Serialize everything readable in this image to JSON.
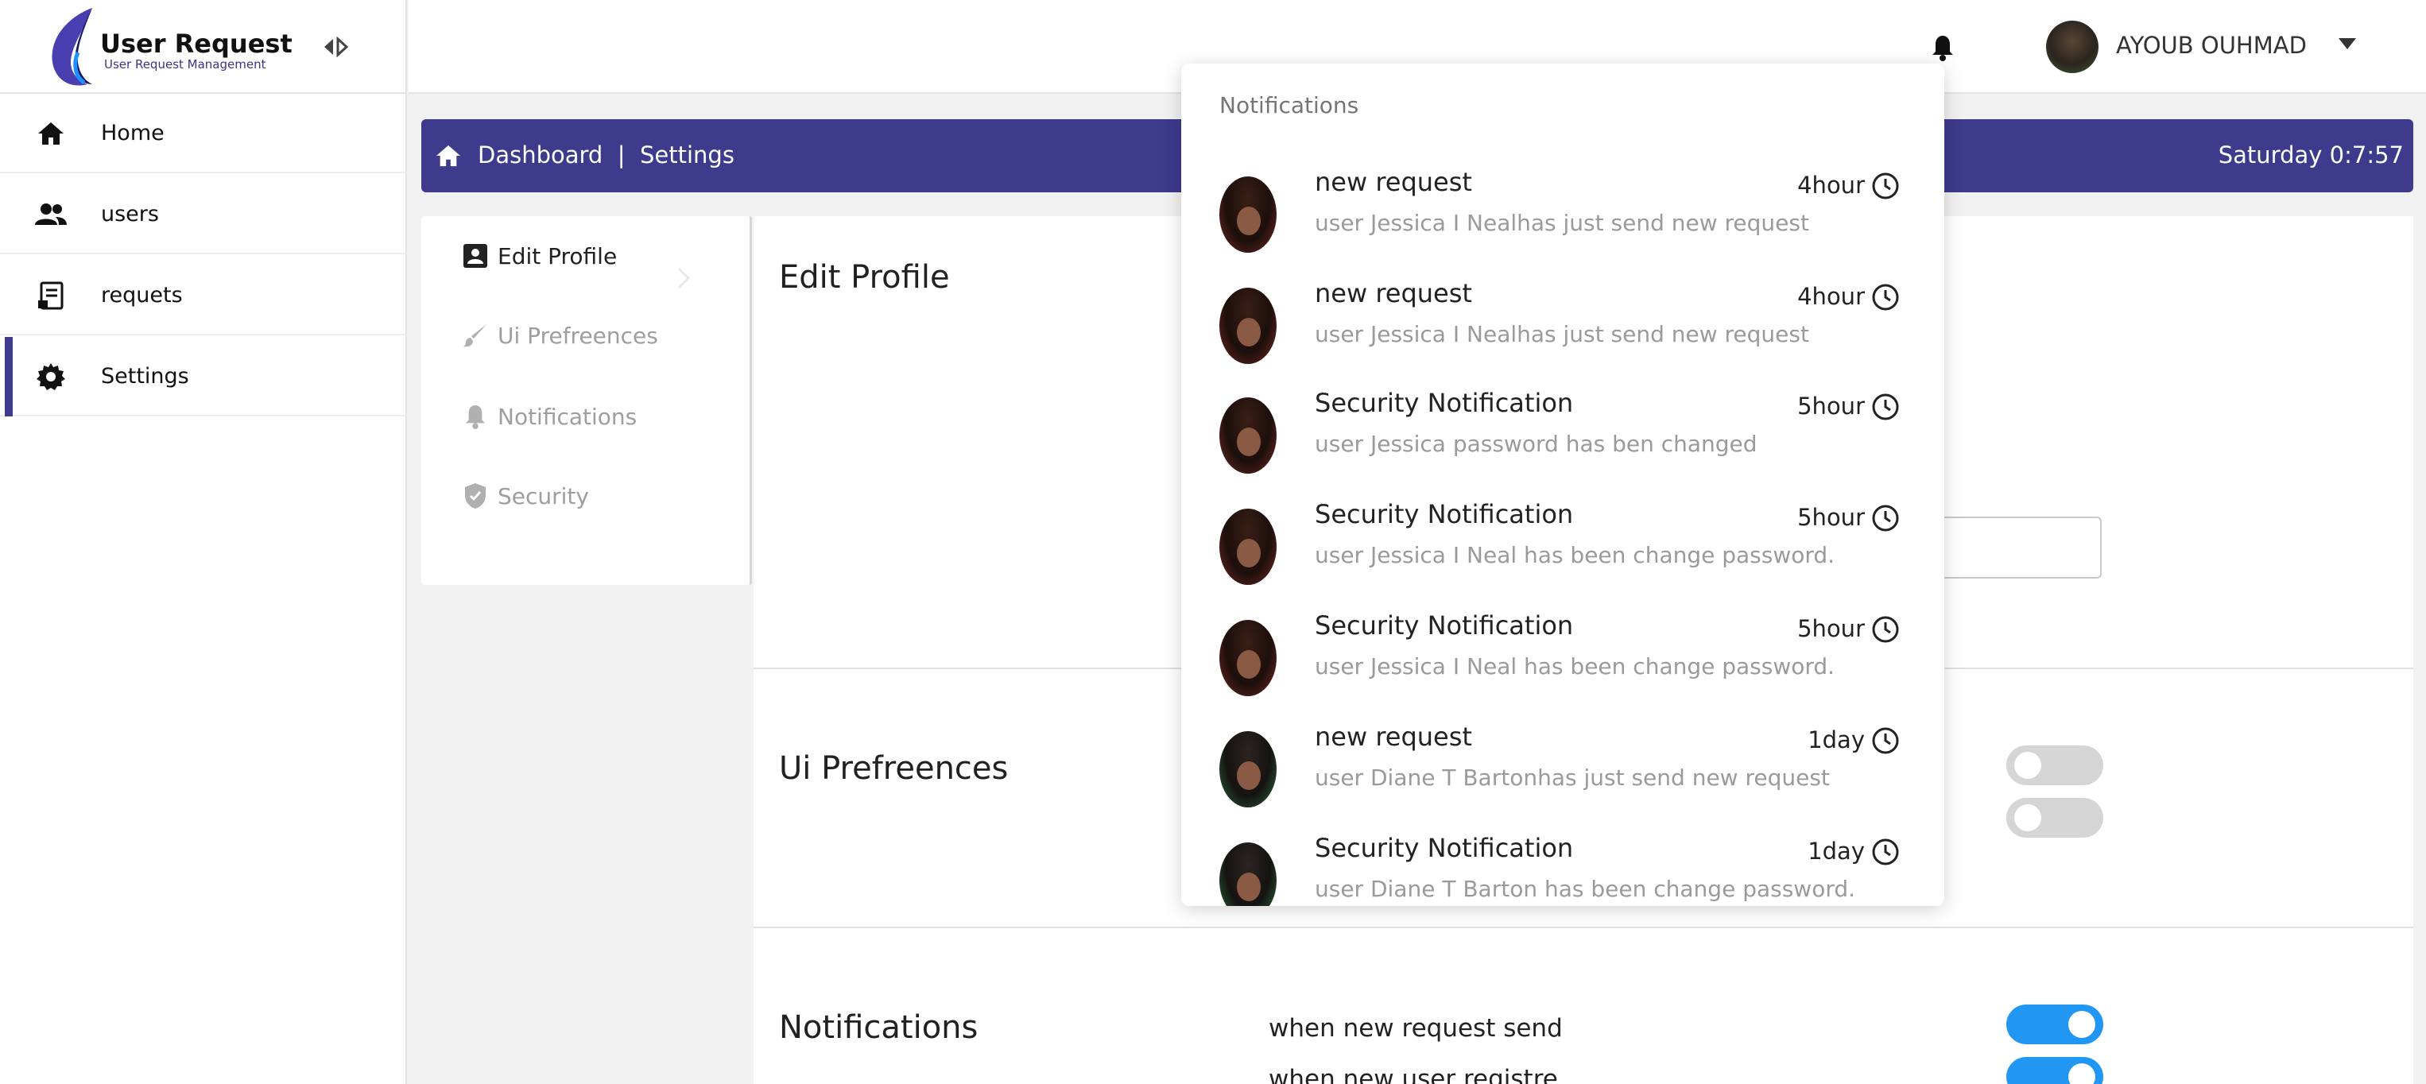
{
  "brand": {
    "title": "User Request",
    "subtitle": "User Request Management"
  },
  "sidebar": {
    "items": [
      {
        "label": "Home",
        "icon": "home-icon",
        "active": false
      },
      {
        "label": "users",
        "icon": "users-icon",
        "active": false
      },
      {
        "label": "requets",
        "icon": "requests-icon",
        "active": false
      },
      {
        "label": "Settings",
        "icon": "gear-icon",
        "active": true
      }
    ]
  },
  "header": {
    "user_name": "AYOUB OUHMAD"
  },
  "breadcrumb": {
    "text": "Dashboard  |  Settings",
    "clock": "Saturday 0:7:57"
  },
  "settings_menu": {
    "items": [
      {
        "label": "Edit Profile",
        "icon": "profile-icon",
        "active": true
      },
      {
        "label": "Ui Prefreences",
        "icon": "brush-icon",
        "active": false
      },
      {
        "label": "Notifications",
        "icon": "bell-icon",
        "active": false
      },
      {
        "label": "Security",
        "icon": "shield-icon",
        "active": false
      }
    ]
  },
  "sections": {
    "edit_profile": "Edit Profile",
    "ui_preferences": "Ui Prefreences",
    "notifications": "Notifications"
  },
  "notification_prefs": [
    {
      "label": "when new request send",
      "enabled": true
    },
    {
      "label": "when new user registre",
      "enabled": true
    }
  ],
  "ui_toggles": [
    {
      "enabled": false
    },
    {
      "enabled": false
    }
  ],
  "notifications_panel": {
    "header": "Notifications",
    "items": [
      {
        "title": "new request",
        "message": "user Jessica I Nealhas just send new request",
        "time": "4hour",
        "avatar": "a"
      },
      {
        "title": "new request",
        "message": "user Jessica I Nealhas just send new request",
        "time": "4hour",
        "avatar": "a"
      },
      {
        "title": "Security Notification",
        "message": "user Jessica password has ben changed",
        "time": "5hour",
        "avatar": "a"
      },
      {
        "title": "Security Notification",
        "message": "user Jessica I Neal has been change password.",
        "time": "5hour",
        "avatar": "a"
      },
      {
        "title": "Security Notification",
        "message": "user Jessica I Neal has been change password.",
        "time": "5hour",
        "avatar": "a"
      },
      {
        "title": "new request",
        "message": "user Diane T Bartonhas just send new request",
        "time": "1day",
        "avatar": "b"
      },
      {
        "title": "Security Notification",
        "message": "user Diane T Barton has been change password.",
        "time": "1day",
        "avatar": "b"
      }
    ]
  },
  "colors": {
    "primary": "#3e3a8c",
    "toggle_on": "#2196f3",
    "toggle_off": "#d5d5d5"
  }
}
